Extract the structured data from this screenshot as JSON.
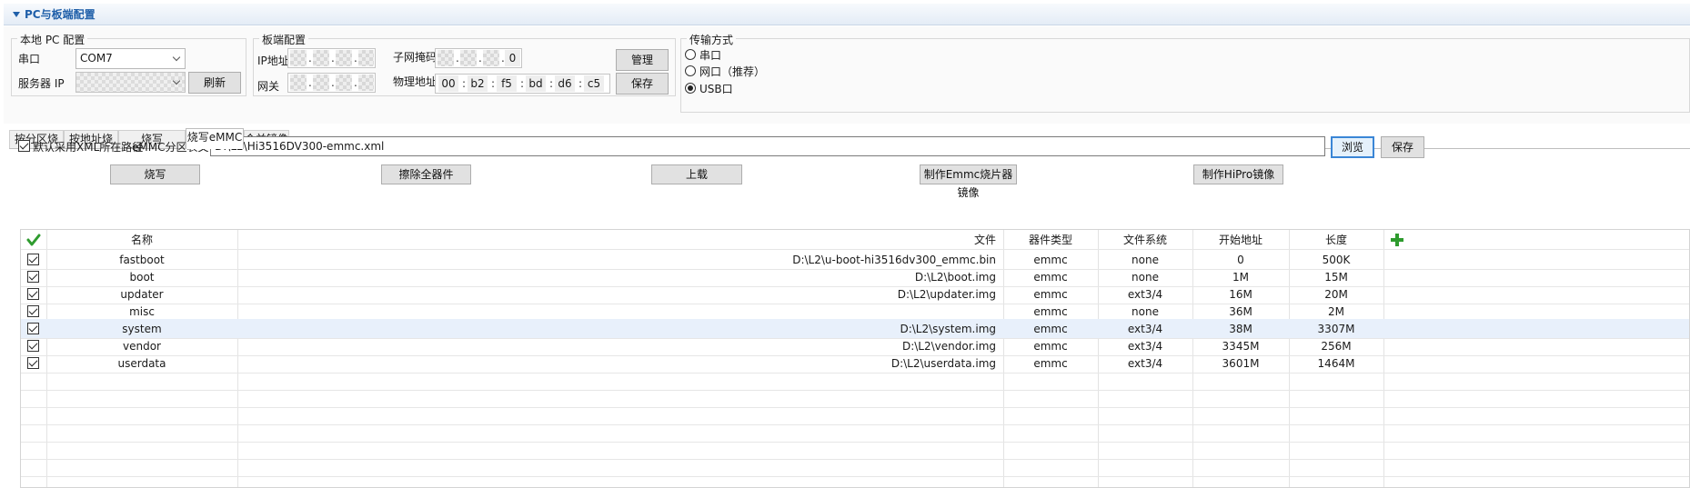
{
  "section": {
    "title": "PC与板端配置"
  },
  "pc_config": {
    "title": "本地 PC 配置",
    "serial_label": "串口",
    "serial_value": "COM7",
    "server_ip_label": "服务器 IP",
    "refresh_label": "刷新"
  },
  "board_config": {
    "title": "板端配置",
    "ip_label": "IP地址",
    "subnet_label": "子网掩码",
    "subnet_last_octet": "0",
    "gateway_label": "网关",
    "mac_label": "物理地址",
    "mac_octets": [
      "00",
      "b2",
      "f5",
      "bd",
      "d6",
      "c5"
    ],
    "manage_label": "管理",
    "save_label": "保存"
  },
  "transfer": {
    "title": "传输方式",
    "options": [
      "串口",
      "网口（推荐）",
      "USB口"
    ],
    "selected": "USB口"
  },
  "tabs": [
    "按分区烧写",
    "按地址烧写",
    "烧写Fastboot",
    "烧写eMMC",
    "合并镜像"
  ],
  "active_tab": "烧写eMMC",
  "emmc": {
    "use_xml_path_label": "默认采用XML所在路径",
    "use_xml_path_checked": true,
    "partition_file_label": "eMMC分区表文件",
    "partition_file_value": "D:\\L2\\Hi3516DV300-emmc.xml",
    "browse_label": "浏览",
    "save_label": "保存",
    "actions": {
      "burn": "烧写",
      "erase_all": "擦除全器件",
      "upload": "上载",
      "make_emmc_image": "制作Emmc烧片器镜像",
      "make_hipro_image": "制作HiPro镜像"
    }
  },
  "table": {
    "headers": {
      "name": "名称",
      "file": "文件",
      "device_type": "器件类型",
      "filesystem": "文件系统",
      "start_address": "开始地址",
      "length": "长度"
    },
    "rows": [
      {
        "checked": true,
        "name": "fastboot",
        "file": "D:\\L2\\u-boot-hi3516dv300_emmc.bin",
        "device_type": "emmc",
        "filesystem": "none",
        "start_address": "0",
        "length": "500K"
      },
      {
        "checked": true,
        "name": "boot",
        "file": "D:\\L2\\boot.img",
        "device_type": "emmc",
        "filesystem": "none",
        "start_address": "1M",
        "length": "15M"
      },
      {
        "checked": true,
        "name": "updater",
        "file": "D:\\L2\\updater.img",
        "device_type": "emmc",
        "filesystem": "ext3/4",
        "start_address": "16M",
        "length": "20M"
      },
      {
        "checked": true,
        "name": "misc",
        "file": "",
        "device_type": "emmc",
        "filesystem": "none",
        "start_address": "36M",
        "length": "2M"
      },
      {
        "checked": true,
        "name": "system",
        "file": "D:\\L2\\system.img",
        "device_type": "emmc",
        "filesystem": "ext3/4",
        "start_address": "38M",
        "length": "3307M",
        "selected": true
      },
      {
        "checked": true,
        "name": "vendor",
        "file": "D:\\L2\\vendor.img",
        "device_type": "emmc",
        "filesystem": "ext3/4",
        "start_address": "3345M",
        "length": "256M"
      },
      {
        "checked": true,
        "name": "userdata",
        "file": "D:\\L2\\userdata.img",
        "device_type": "emmc",
        "filesystem": "ext3/4",
        "start_address": "3601M",
        "length": "1464M"
      }
    ]
  },
  "icons": {
    "section_toggle": "triangle-down-icon",
    "check_all": "green-checkmark-icon",
    "add_row": "green-plus-icon",
    "combo_arrow": "chevron-down-icon"
  },
  "colors": {
    "accent": "#1f5fa9",
    "selected_row": "#e8f0fb",
    "green_icon": "#2e9b2e"
  }
}
